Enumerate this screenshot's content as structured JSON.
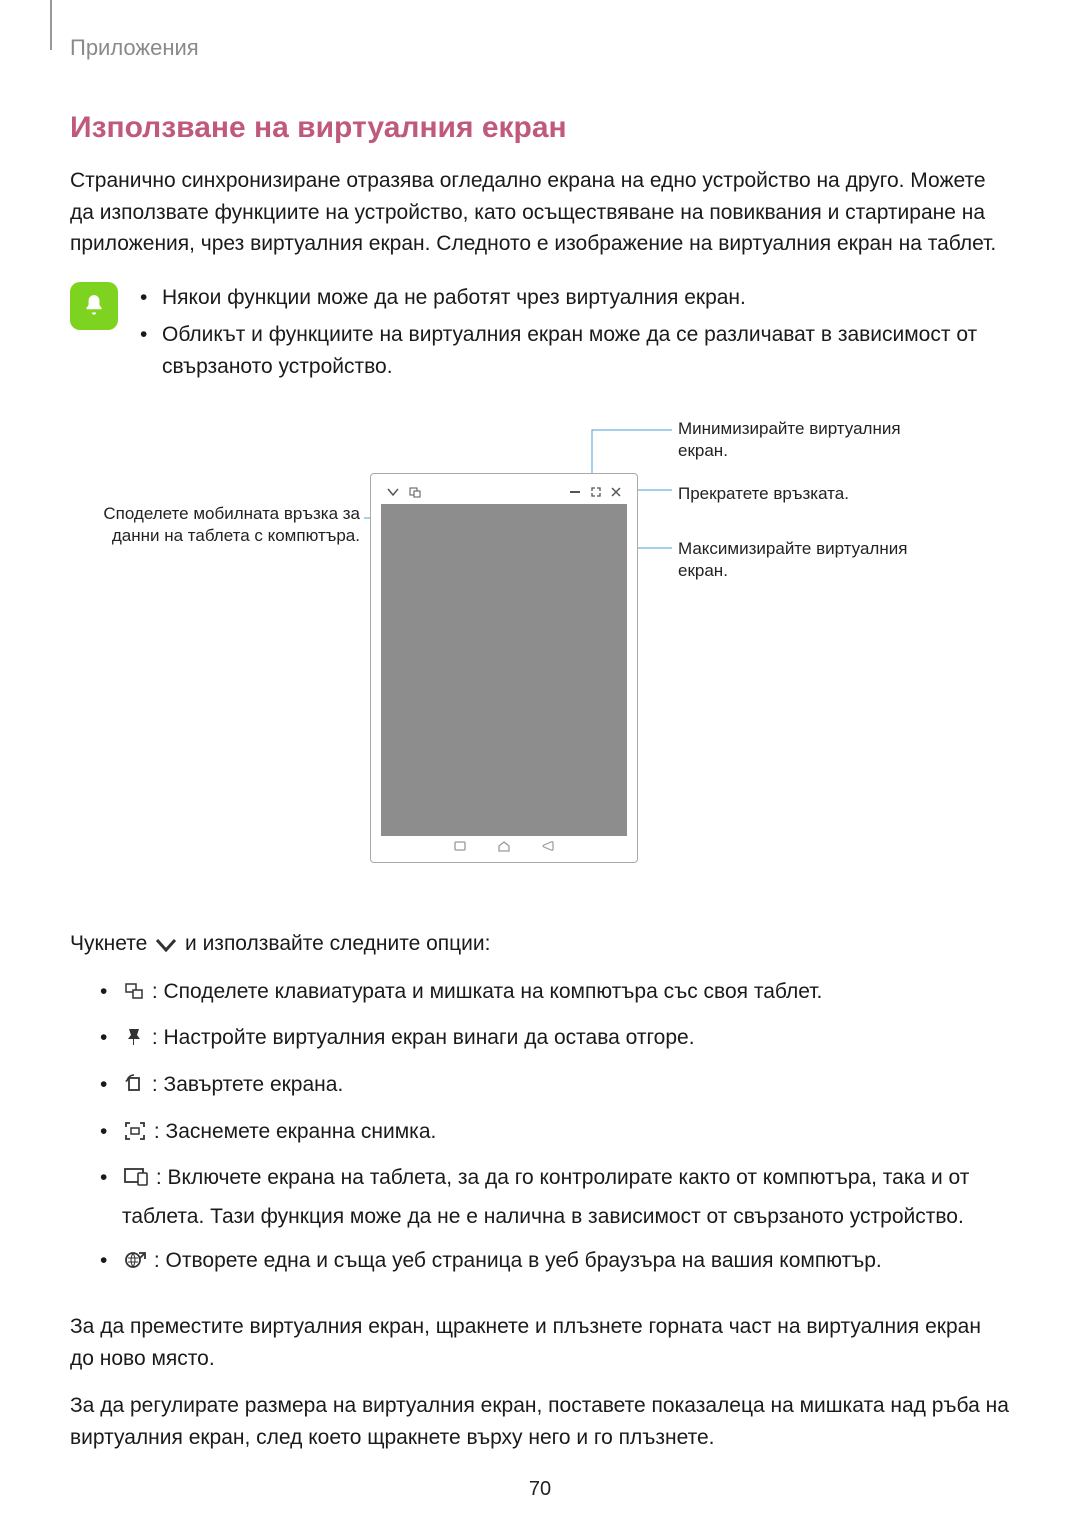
{
  "breadcrumb": "Приложения",
  "section_title": "Използване на виртуалния екран",
  "intro": "Странично синхронизиране отразява огледално екрана на едно устройство на друго. Можете да използвате функциите на устройство, като осъществяване на повиквания и стартиране на приложения, чрез виртуалния екран. Следното е изображение на виртуалния екран на таблет.",
  "note_items": [
    "Някои функции може да не работят чрез виртуалния екран.",
    "Обликът и функциите на виртуалния екран може да се различават в зависимост от свързаното устройство."
  ],
  "callouts": {
    "left": "Споделете мобилната връзка за данни на таблета с компютъра.",
    "minimize": "Минимизирайте виртуалния екран.",
    "close": "Прекратете връзката.",
    "maximize": "Максимизирайте виртуалния екран."
  },
  "tap_line_pre": "Чукнете ",
  "tap_line_post": " и използвайте следните опции:",
  "options": [
    " : Споделете клавиатурата и мишката на компютъра със своя таблет.",
    " : Настройте виртуалния екран винаги да остава отгоре.",
    " : Завъртете екрана.",
    " : Заснемете екранна снимка.",
    " : Включете екрана на таблета, за да го контролирате както от компютъра, така и от таблета. Тази функция може да не е налична в зависимост от свързаното устройство.",
    " : Отворете една и съща уеб страница в уеб браузъра на вашия компютър."
  ],
  "para_move": "За да преместите виртуалния екран, щракнете и плъзнете горната част на виртуалния екран до ново място.",
  "para_resize": "За да регулирате размера на виртуалния екран, поставете показалеца на мишката над ръба на виртуалния екран, след което щракнете върху него и го плъзнете.",
  "page_number": "70"
}
